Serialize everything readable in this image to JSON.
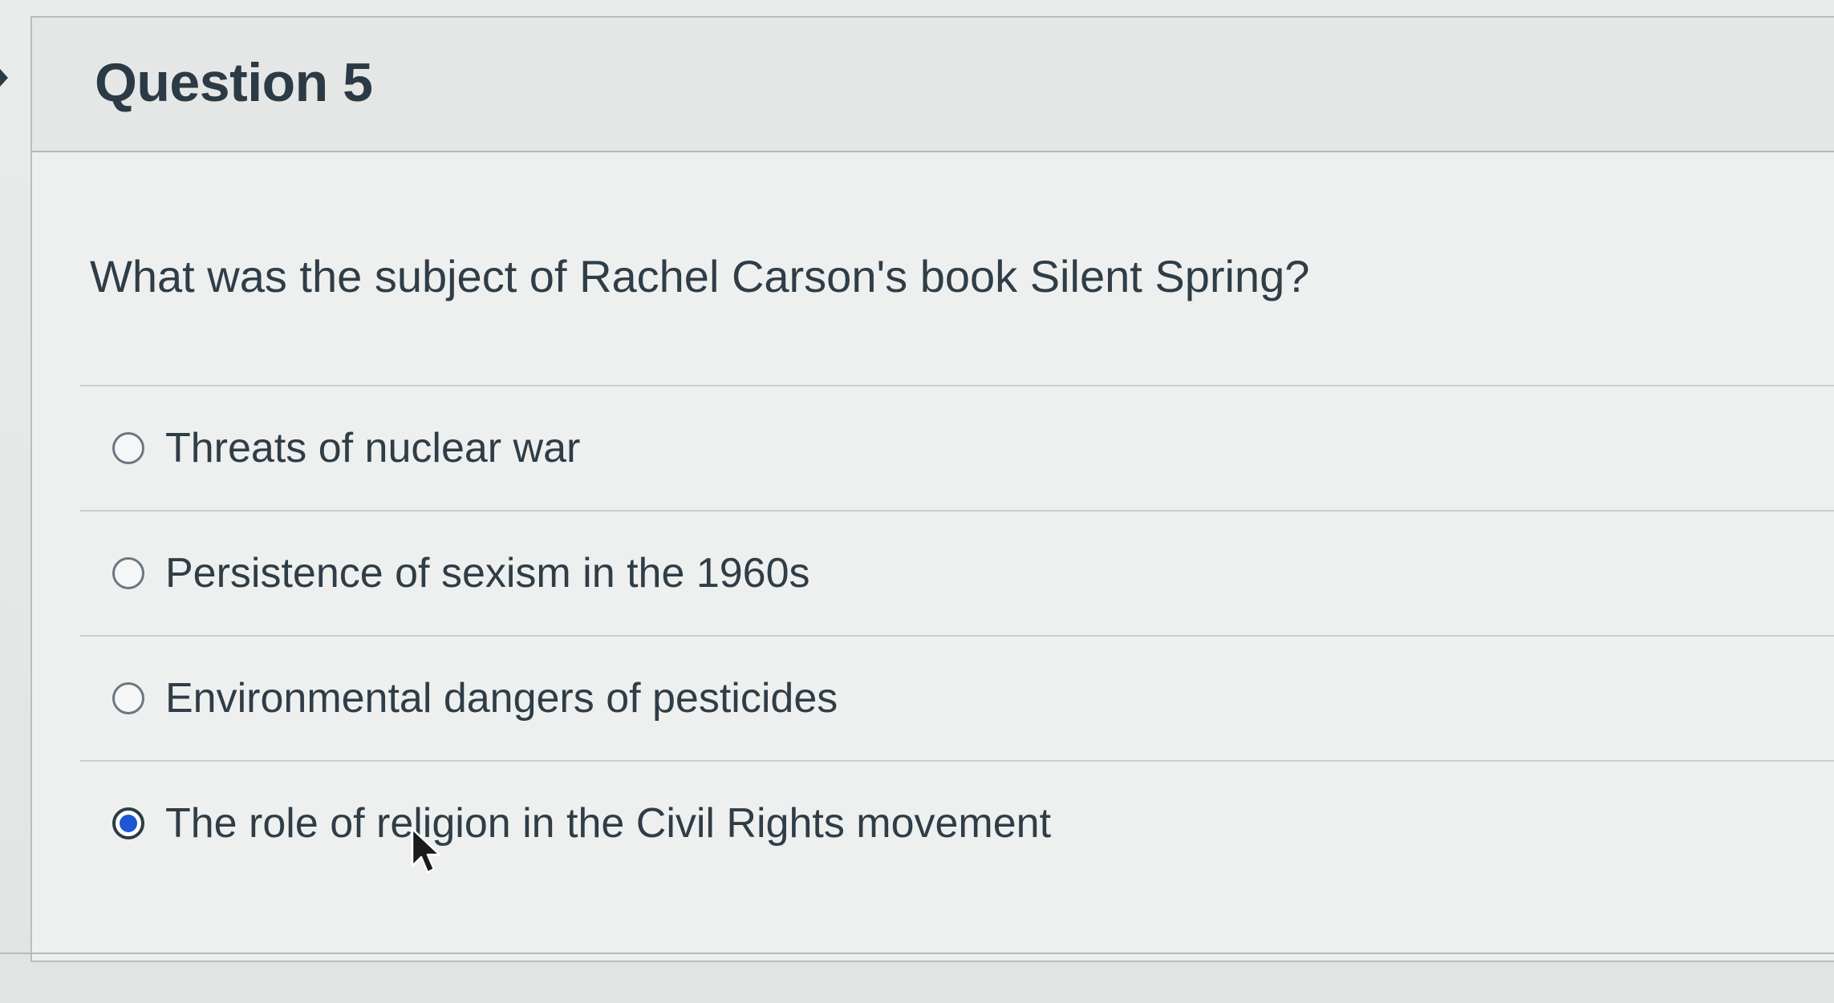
{
  "question": {
    "title": "Question 5",
    "text": "What was the subject of Rachel Carson's book Silent Spring?"
  },
  "answers": [
    {
      "label": "Threats of nuclear war",
      "selected": false
    },
    {
      "label": "Persistence of sexism in the 1960s",
      "selected": false
    },
    {
      "label": "Environmental dangers of pesticides",
      "selected": false
    },
    {
      "label": "The role of religion in the Civil Rights movement",
      "selected": true
    }
  ],
  "colors": {
    "selected_radio_fill": "#1f56d6",
    "text": "#2f3d47"
  },
  "icons": {
    "pointer": "mouse-pointer-icon",
    "radio": "radio-circle-icon"
  }
}
